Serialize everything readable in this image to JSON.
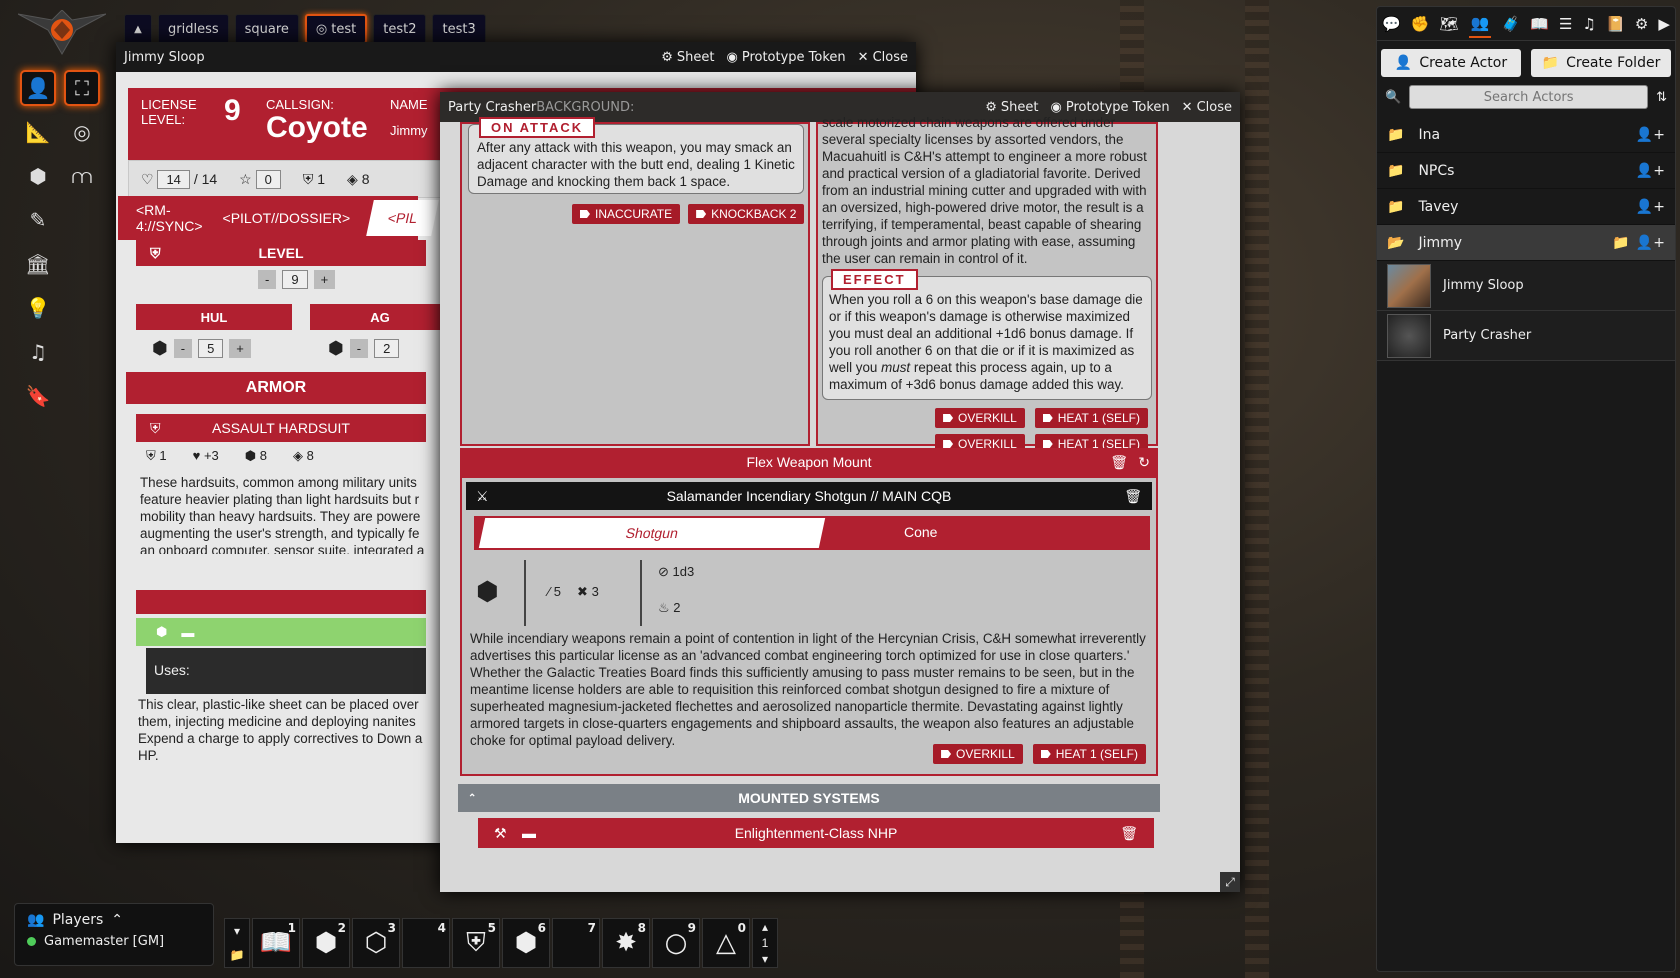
{
  "nav": {
    "scenes": [
      "gridless",
      "square",
      "test",
      "test2",
      "test3"
    ],
    "active_scene": "test"
  },
  "jimmy_sheet": {
    "title": "Jimmy Sloop",
    "header_buttons": {
      "sheet": "Sheet",
      "prototype": "Prototype Token",
      "close": "Close"
    },
    "license_label": "LICENSE LEVEL:",
    "license_value": "9",
    "callsign_label": "CALLSIGN:",
    "callsign_value": "Coyote",
    "name_label": "NAME",
    "name_value": "Jimmy",
    "hp_current": "14",
    "hp_sep": "/",
    "hp_max": "14",
    "armor_val": "0",
    "evasion_val": "1",
    "edef_val": "8",
    "tabs": [
      "<RM-4://SYNC>",
      "<PILOT//DOSSIER>",
      "<PIL"
    ],
    "level_label": "LEVEL",
    "level_value": "9",
    "hul_label": "HUL",
    "hul_value": "5",
    "agi_label": "AG",
    "agi_value": "2",
    "minus": "-",
    "plus": "+",
    "armor_heading": "ARMOR",
    "armor_name": "ASSAULT HARDSUIT",
    "armor_stats": [
      "1",
      "+3",
      "8",
      "8"
    ],
    "armor_desc": "These hardsuits, common among military units feature heavier plating than light hardsuits but r mobility than heavy hardsuits. They are powere augmenting the user's strength, and typically fe an onboard computer, sensor suite, integrated a burst EVA system, and waste recycling systems",
    "uses_label": "Uses:",
    "gear_desc": "This clear, plastic-like sheet can be placed over them, injecting medicine and deploying nanites Expend a charge to apply correctives to Down a HP."
  },
  "party_sheet": {
    "title": "Party Crasher",
    "background_label": "BACKGROUND:",
    "header_buttons": {
      "sheet": "Sheet",
      "prototype": "Prototype Token",
      "close": "Close"
    },
    "on_attack_label": "ON ATTACK",
    "on_attack_text": "After any attack with this weapon, you may smack an adjacent character with the butt end, dealing 1 Kinetic Damage and knocking them back 1 space.",
    "left_tags": [
      "INACCURATE",
      "KNOCKBACK 2"
    ],
    "right_top_text": "scale motorized chain weapons are offered under several specialty licenses by assorted vendors, the Macuahuitl is C&H's attempt to engineer a more robust and practical version of a gladiatorial favorite. Derived from an industrial mining cutter and upgraded with with an oversized, high-powered drive motor, the result is a terrifying, if temperamental, beast capable of shearing through joints and armor plating with ease, assuming the user can remain in control of it.",
    "effect_label": "EFFECT",
    "effect_text_1": "When you roll a 6 on this weapon's base damage die or if this weapon's damage is otherwise maximized you must deal an additional +1d6 bonus damage. If you roll another 6 on that die or if it is maximized as well you ",
    "effect_text_em": "must",
    "effect_text_2": " repeat this process again, up to a maximum of +3d6 bonus damage added this way.",
    "right_tags": [
      "OVERKILL",
      "HEAT 1 (SELF)",
      "OVERKILL",
      "HEAT 1 (SELF)"
    ],
    "mount_label": "Flex Weapon Mount",
    "weapon_name": "Salamander Incendiary Shotgun // MAIN CQB",
    "weapon_tab_1": "Shotgun",
    "weapon_tab_2": "Cone",
    "range_val": "5",
    "cone_val": "3",
    "damage_val": "1d3",
    "heat_val": "2",
    "weapon_desc": "While incendiary weapons remain a point of contention in light of the Hercynian Crisis, C&H somewhat irreverently advertises this particular license as an 'advanced combat engineering torch optimized for use in close quarters.' Whether the Galactic Treaties Board finds this sufficiently amusing to pass muster remains to be seen, but in the meantime license holders are able to requisition this reinforced combat shotgun designed to fire a mixture of superheated magnesium-jacketed flechettes and aerosolized nanoparticle thermite. Devastating against lightly armored targets in close-quarters engagements and shipboard assaults, the weapon also features an adjustable choke for optimal payload delivery.",
    "weapon_tags": [
      "OVERKILL",
      "HEAT 1 (SELF)"
    ],
    "systems_label": "MOUNTED SYSTEMS",
    "system_name": "Enlightenment-Class NHP"
  },
  "sidebar": {
    "create_actor": "Create Actor",
    "create_folder": "Create Folder",
    "search_placeholder": "Search Actors",
    "folders": [
      "Ina",
      "NPCs",
      "Tavey",
      "Jimmy"
    ],
    "actors": [
      "Jimmy Sloop",
      "Party Crasher"
    ]
  },
  "players": {
    "label": "Players",
    "entries": [
      "Gamemaster [GM]"
    ]
  },
  "hotbar": {
    "slots": [
      "1",
      "2",
      "3",
      "4",
      "5",
      "6",
      "7",
      "8",
      "9",
      "0"
    ],
    "page": "1"
  },
  "colors": {
    "accent": "#b12030",
    "highlight": "#e25412",
    "bg": "#191919"
  }
}
